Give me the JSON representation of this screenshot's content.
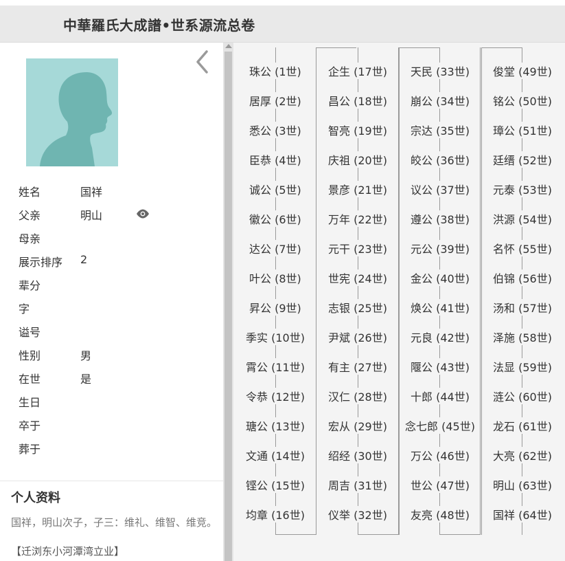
{
  "header": {
    "title": "中華羅氏大成譜•世系源流总卷"
  },
  "profile": {
    "fields": [
      {
        "label": "姓名",
        "value": "国祥"
      },
      {
        "label": "父亲",
        "value": "明山"
      },
      {
        "label": "母亲",
        "value": ""
      },
      {
        "label": "展示排序",
        "value": "2"
      },
      {
        "label": "辈分",
        "value": ""
      },
      {
        "label": "字",
        "value": ""
      },
      {
        "label": "谥号",
        "value": ""
      },
      {
        "label": "性别",
        "value": "男"
      },
      {
        "label": "在世",
        "value": "是"
      },
      {
        "label": "生日",
        "value": ""
      },
      {
        "label": "卒于",
        "value": ""
      },
      {
        "label": "葬于",
        "value": ""
      }
    ],
    "bio_title": "个人资料",
    "bio_text": "国祥，明山次子，子三：维礼、维智、维竞。",
    "bio_note": "【迁浏东小河潭湾立业】"
  },
  "icons": {
    "back": "chevron-left-icon",
    "eye": "eye-icon",
    "avatar": "person-silhouette-icon"
  },
  "colors": {
    "avatar_bg": "#a6d9d8",
    "avatar_fg": "#6fb5b1",
    "header_bg": "#e9e9e9",
    "panel_bg": "#f4f4f4"
  },
  "generations": [
    [
      "珠公 (1世)",
      "居厚 (2世)",
      "悉公 (3世)",
      "臣恭 (4世)",
      "诚公 (5世)",
      "徽公 (6世)",
      "达公 (7世)",
      "叶公 (8世)",
      "昇公 (9世)",
      "季实 (10世)",
      "霄公 (11世)",
      "令恭 (12世)",
      "瑭公 (13世)",
      "文通 (14世)",
      "铿公 (15世)",
      "均章 (16世)"
    ],
    [
      "企生 (17世)",
      "昌公 (18世)",
      "智亮 (19世)",
      "庆祖 (20世)",
      "景彦 (21世)",
      "万年 (22世)",
      "元干 (23世)",
      "世宪 (24世)",
      "志银 (25世)",
      "尹斌 (26世)",
      "有主 (27世)",
      "汉仁 (28世)",
      "宏从 (29世)",
      "绍经 (30世)",
      "周吉 (31世)",
      "仪举 (32世)"
    ],
    [
      "天民 (33世)",
      "崩公 (34世)",
      "宗达 (35世)",
      "皎公 (36世)",
      "议公 (37世)",
      "遵公 (38世)",
      "元公 (39世)",
      "金公 (40世)",
      "焕公 (41世)",
      "元良 (42世)",
      "隁公 (43世)",
      "十郎 (44世)",
      "念七郎 (45世)",
      "万公 (46世)",
      "世公 (47世)",
      "友亮 (48世)"
    ],
    [
      "俊堂 (49世)",
      "铭公 (50世)",
      "璋公 (51世)",
      "廷缙 (52世)",
      "元泰 (53世)",
      "洪源 (54世)",
      "名怀 (55世)",
      "伯锦 (56世)",
      "汤和 (57世)",
      "泽施 (58世)",
      "法显 (59世)",
      "涟公 (60世)",
      "龙石 (61世)",
      "大亮 (62世)",
      "明山 (63世)",
      "国祥 (64世)"
    ]
  ]
}
